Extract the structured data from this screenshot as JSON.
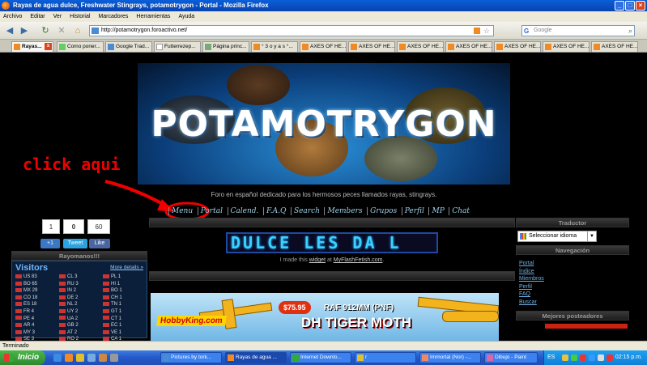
{
  "window": {
    "title": "Rayas de agua dulce, Freshwater Stingrays, potamotrygon - Portal - Mozilla Firefox"
  },
  "menu": [
    "Archivo",
    "Editar",
    "Ver",
    "Historial",
    "Marcadores",
    "Herramientas",
    "Ayuda"
  ],
  "url": "http://potamotrygon.foroactivo.net/",
  "search": {
    "placeholder": "Google"
  },
  "tabs": [
    "Rayas...",
    "Como poner...",
    "Google Trad...",
    "Futterrezep...",
    "Página princ...",
    "° 3 o y a s °...",
    "AXES OF HE...",
    "AXES OF HE...",
    "AXES OF HE...",
    "AXES OF HE...",
    "AXES OF HE...",
    "AXES OF HE..."
  ],
  "banner": {
    "logo": "POTAMOTRYGON",
    "tagline": "Foro en español dedicado para los hermosos peces llamados rayas, stingrays."
  },
  "forum_nav": [
    "Menu",
    "Portal",
    "Calend.",
    "F.A.Q",
    "Search",
    "Members",
    "Grupos",
    "Perfil",
    "MP",
    "Chat"
  ],
  "annotation": "click aqui",
  "social": {
    "count1": "1",
    "count2": "0",
    "like_count": "60",
    "plus": "+1",
    "tweet": "Tweet",
    "like": "Like"
  },
  "left": {
    "header": "Rayomanos!!!",
    "visitors_title": "Visitors",
    "more": "More details »",
    "visitors": [
      [
        "US",
        "83"
      ],
      [
        "CL",
        "3"
      ],
      [
        "PL",
        "1"
      ],
      [
        "BO",
        "65"
      ],
      [
        "RU",
        "3"
      ],
      [
        "HI",
        "1"
      ],
      [
        "MX",
        "29"
      ],
      [
        "IN",
        "2"
      ],
      [
        "BO",
        "1"
      ],
      [
        "CO",
        "18"
      ],
      [
        "DE",
        "2"
      ],
      [
        "CH",
        "1"
      ],
      [
        "ES",
        "18"
      ],
      [
        "NL",
        "2"
      ],
      [
        "TN",
        "1"
      ],
      [
        "FR",
        "4"
      ],
      [
        "UY",
        "2"
      ],
      [
        "GT",
        "1"
      ],
      [
        "PE",
        "4"
      ],
      [
        "UA",
        "2"
      ],
      [
        "CT",
        "1"
      ],
      [
        "AR",
        "4"
      ],
      [
        "GB",
        "2"
      ],
      [
        "EC",
        "1"
      ],
      [
        "MY",
        "3"
      ],
      [
        "AT",
        "2"
      ],
      [
        "VE",
        "1"
      ],
      [
        "SE",
        "3"
      ],
      [
        "RO",
        "2"
      ],
      [
        "CA",
        "1"
      ]
    ]
  },
  "center": {
    "ticker": "DULCE LES DA L",
    "widget_cap_pre": "I made this ",
    "widget_link": "widget",
    "widget_cap_mid": " at ",
    "widget_site": "MyFlashFetish.com",
    "widget_dot": "."
  },
  "ad": {
    "brand": "HobbyKing.com",
    "price": "$75.95",
    "line1": "RAF 912MM (PNF)",
    "line2": "DH TIGER MOTH"
  },
  "right": {
    "translator_header": "Traductor",
    "translator_select": "Seleccionar idioma",
    "nav_header": "Navegación",
    "nav_links": [
      "Portal",
      "Índice",
      "Miembros",
      "Perfil",
      "FAQ",
      "Buscar"
    ],
    "posters_header": "Mejores posteadores"
  },
  "status": "Terminado",
  "taskbar": {
    "start": "Inicio",
    "buttons": [
      "Pictures by tork...",
      "Rayas de agua ...",
      "Internet Downlo...",
      "r",
      "Immortal (Nor) -...",
      "Dibujo - Paint"
    ],
    "lang": "ES",
    "clock": "02:15 p.m."
  },
  "colors": {
    "annotation": "#e00000",
    "xp_blue": "#245edb",
    "link": "#6cb0e0"
  }
}
